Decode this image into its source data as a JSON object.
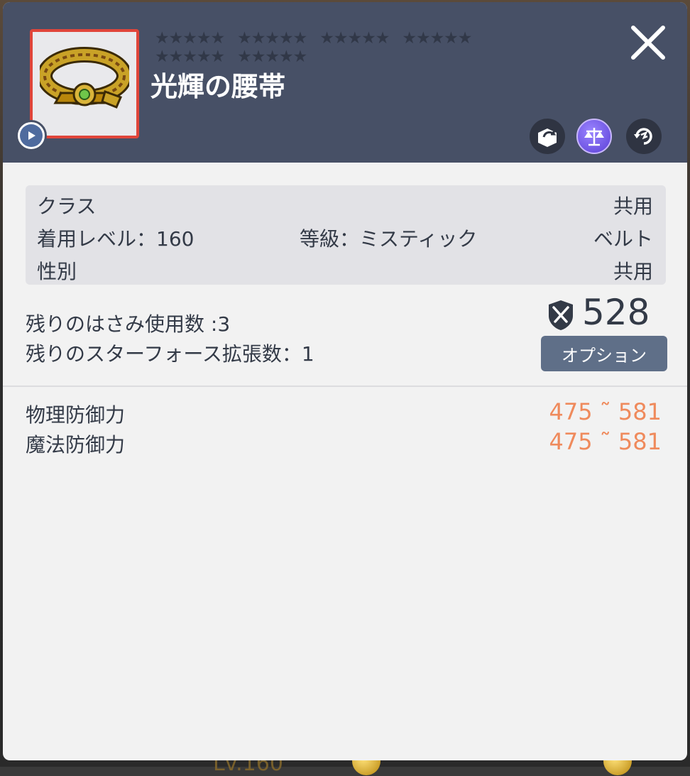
{
  "item": {
    "name": "光輝の腰帯",
    "star_slots": [
      "★★★★★",
      "★★★★★",
      "★★★★★",
      "★★★★★",
      "★★★★★",
      "★★★★★"
    ]
  },
  "header_icons": [
    "transfer-icon",
    "scale-icon",
    "reset-icon"
  ],
  "info": {
    "class_label": "クラス",
    "class_value": "共用",
    "level_label": "着用レベル：160",
    "grade_label": "等級：ミスティック",
    "type_value": "ベルト",
    "gender_label": "性別",
    "gender_value": "共用"
  },
  "remaining": {
    "scissors": "残りのはさみ使用数 :3",
    "starforce": "残りのスターフォース拡張数：1"
  },
  "attack_power": "528",
  "option_button": "オプション",
  "stats": [
    {
      "label": "物理防御力",
      "value": "475 ˜ 581"
    },
    {
      "label": "魔法防御力",
      "value": "475 ˜ 581"
    }
  ],
  "background_text": "Lv.160",
  "colors": {
    "header_bg": "#475066",
    "body_bg": "#f2f2f2",
    "stat_value": "#ef8a5c",
    "frame_border": "#e0453a",
    "button_bg": "#5f6f88"
  }
}
